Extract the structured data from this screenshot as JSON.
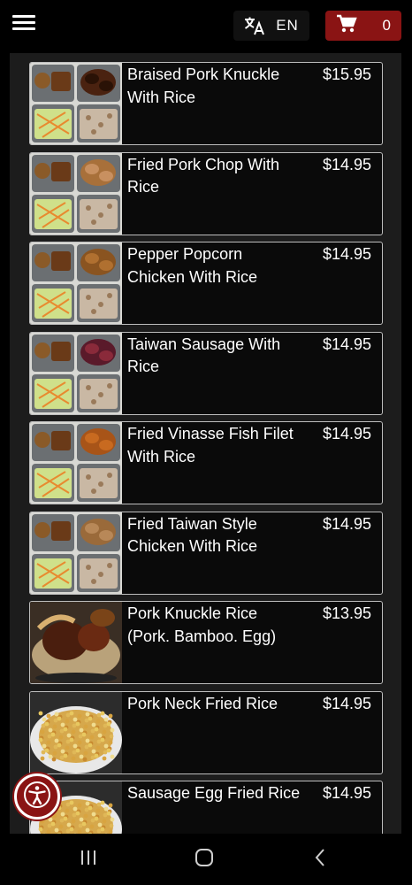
{
  "header": {
    "language_label": "EN",
    "cart_count": "0",
    "cart_color": "#8a1414"
  },
  "menu_items": [
    {
      "name": "Braised Pork Knuckle With Rice",
      "price": "$15.95",
      "image": "bento-braised-pork"
    },
    {
      "name": "Fried Pork Chop With Rice",
      "price": "$14.95",
      "image": "bento-pork-chop"
    },
    {
      "name": "Pepper Popcorn Chicken With Rice",
      "price": "$14.95",
      "image": "bento-popcorn-chicken"
    },
    {
      "name": "Taiwan Sausage With Rice",
      "price": "$14.95",
      "image": "bento-sausage"
    },
    {
      "name": "Fried Vinasse Fish Filet With Rice",
      "price": "$14.95",
      "image": "bento-fish"
    },
    {
      "name": "Fried Taiwan Style Chicken With Rice",
      "price": "$14.95",
      "image": "bento-fried-chicken"
    },
    {
      "name": "Pork Knuckle Rice (Pork. Bamboo. Egg)",
      "price": "$13.95",
      "image": "pork-knuckle-bowl"
    },
    {
      "name": "Pork Neck Fried Rice",
      "price": "$14.95",
      "image": "fried-rice"
    },
    {
      "name": "Sausage Egg Fried Rice",
      "price": "$14.95",
      "image": "fried-rice"
    }
  ],
  "icons": {
    "menu": "hamburger-icon",
    "language": "translate-icon",
    "cart": "cart-icon",
    "accessibility": "accessibility-icon",
    "recents": "recents-icon",
    "home": "home-icon",
    "back": "back-icon"
  }
}
